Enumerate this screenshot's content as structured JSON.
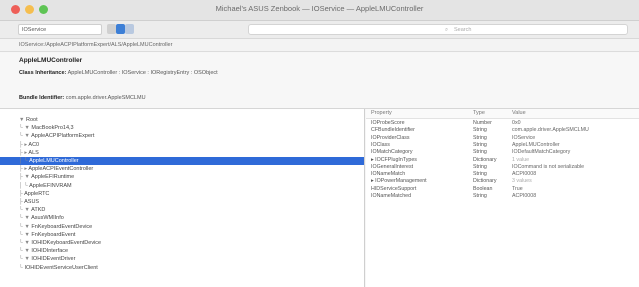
{
  "window": {
    "title": "Michael's ASUS Zenbook — IOService — AppleLMUController"
  },
  "toolbar": {
    "service_value": "IOService",
    "search_placeholder": "Search"
  },
  "pathbar": {
    "path": "IOService:/AppleACPIPlatformExpert/ALS/AppleLMUController"
  },
  "info": {
    "object_name": "AppleLMUController",
    "class_inheritance_label": "Class Inheritance:",
    "class_inheritance_value": "AppleLMUController : IOService : IORegistryEntry : OSObject",
    "bundle_id_label": "Bundle Identifier:",
    "bundle_id_value": "com.apple.driver.AppleSMCLMU"
  },
  "tree": [
    {
      "guide": "▼ ",
      "label": "Root"
    },
    {
      "guide": "└ ▼ ",
      "label": "MacBookPro14,3"
    },
    {
      "guide": "   └ ▼ ",
      "label": "AppleACPIPlatformExpert"
    },
    {
      "guide": "      ├ ▸ ",
      "label": "AC0"
    },
    {
      "guide": "      ├ ▸ ",
      "label": "ALS"
    },
    {
      "guide": "      │  └ ",
      "label": "AppleLMUController"
    },
    {
      "guide": "      ├ ▸ ",
      "label": "AppleACPIEventController"
    },
    {
      "guide": "      ├ ▼ ",
      "label": "AppleEFIRuntime"
    },
    {
      "guide": "      │  └ ",
      "label": "AppleEFINVRAM"
    },
    {
      "guide": "      ├ ",
      "label": "AppleRTC"
    },
    {
      "guide": "      ├ ",
      "label": "ASUS"
    },
    {
      "guide": "      └ ▼ ",
      "label": "ATKD"
    },
    {
      "guide": "         └ ▼ ",
      "label": "AsusWMIInfo"
    },
    {
      "guide": "            └ ▼ ",
      "label": "FnKeyboardEventDevice"
    },
    {
      "guide": "               └ ▼ ",
      "label": "FnKeyboardEvent"
    },
    {
      "guide": "                  └ ▼ ",
      "label": "IOHIDKeyboardEventDevice"
    },
    {
      "guide": "                     └ ▼ ",
      "label": "IOHIDInterface"
    },
    {
      "guide": "                        └ ▼ ",
      "label": "IOHIDEventDriver"
    },
    {
      "guide": "                           └ ",
      "label": "IOHIDEventServiceUserClient"
    }
  ],
  "selected_index": 5,
  "properties": {
    "headers": [
      "Property",
      "Type",
      "Value"
    ],
    "rows": [
      {
        "key": "IOProbeScore",
        "type": "Number",
        "value": "0x0",
        "muted": false
      },
      {
        "key": "CFBundleIdentifier",
        "type": "String",
        "value": "com.apple.driver.AppleSMCLMU",
        "muted": false
      },
      {
        "key": "IOProviderClass",
        "type": "String",
        "value": "IOService",
        "muted": false
      },
      {
        "key": "IOClass",
        "type": "String",
        "value": "AppleLMUController",
        "muted": false
      },
      {
        "key": "IOMatchCategory",
        "type": "String",
        "value": "IODefaultMatchCategory",
        "muted": false
      },
      {
        "key": "▸ IOCFPlugInTypes",
        "type": "Dictionary",
        "value": "1 value",
        "muted": true
      },
      {
        "key": "IOGeneralInterest",
        "type": "String",
        "value": "IOCommand is not serializable",
        "muted": false
      },
      {
        "key": "IONameMatch",
        "type": "String",
        "value": "ACPI0008",
        "muted": false
      },
      {
        "key": "▸ IOPowerManagement",
        "type": "Dictionary",
        "value": "3 values",
        "muted": true
      },
      {
        "key": "HIDServiceSupport",
        "type": "Boolean",
        "value": "True",
        "muted": false
      },
      {
        "key": "IONameMatched",
        "type": "String",
        "value": "ACPI0008",
        "muted": false
      }
    ]
  }
}
